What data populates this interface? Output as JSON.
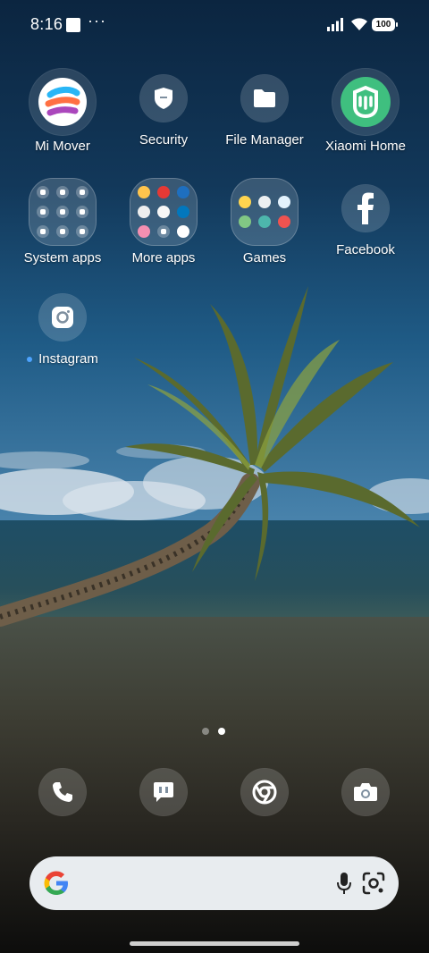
{
  "status": {
    "time": "8:16",
    "battery": "100",
    "overflow": "···"
  },
  "apps": [
    {
      "label": "Mi Mover"
    },
    {
      "label": "Security"
    },
    {
      "label": "File Manager"
    },
    {
      "label": "Xiaomi Home"
    },
    {
      "label": "System apps"
    },
    {
      "label": "More apps"
    },
    {
      "label": "Games"
    },
    {
      "label": "Facebook"
    },
    {
      "label": "Instagram"
    }
  ],
  "dock": [
    "phone-icon",
    "messages-icon",
    "chrome-icon",
    "camera-icon"
  ],
  "colors": {
    "accent": "#4da3ff",
    "searchbar": "#e8ecef"
  }
}
